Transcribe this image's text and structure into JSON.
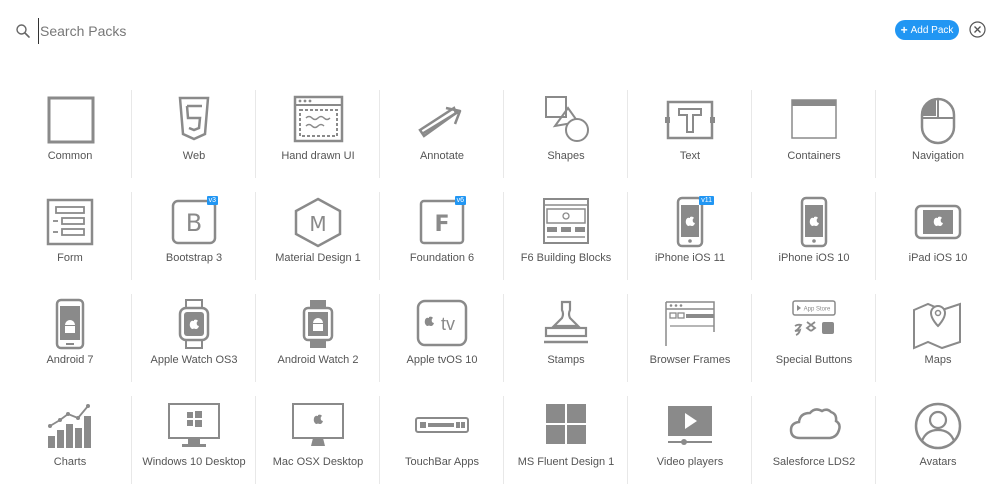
{
  "search": {
    "placeholder": "Search Packs"
  },
  "toolbar": {
    "add_pack_label": "Add Pack",
    "add_pack_plus": "+"
  },
  "packs": [
    {
      "label": "Common",
      "icon": "square-icon"
    },
    {
      "label": "Web",
      "icon": "html5-icon"
    },
    {
      "label": "Hand drawn UI",
      "icon": "hand-drawn-window-icon"
    },
    {
      "label": "Annotate",
      "icon": "arrow-icon"
    },
    {
      "label": "Shapes",
      "icon": "shapes-icon"
    },
    {
      "label": "Text",
      "icon": "text-icon"
    },
    {
      "label": "Containers",
      "icon": "container-icon"
    },
    {
      "label": "Navigation",
      "icon": "mouse-icon"
    },
    {
      "label": "Form",
      "icon": "form-icon"
    },
    {
      "label": "Bootstrap 3",
      "icon": "bootstrap-icon",
      "badge": "v3"
    },
    {
      "label": "Material Design 1",
      "icon": "material-icon"
    },
    {
      "label": "Foundation 6",
      "icon": "foundation-icon",
      "badge": "v6"
    },
    {
      "label": "F6 Building Blocks",
      "icon": "building-blocks-icon"
    },
    {
      "label": "iPhone iOS 11",
      "icon": "iphone-icon",
      "badge": "v11"
    },
    {
      "label": "iPhone iOS 10",
      "icon": "iphone-dark-icon"
    },
    {
      "label": "iPad iOS 10",
      "icon": "ipad-icon"
    },
    {
      "label": "Android 7",
      "icon": "android-phone-icon"
    },
    {
      "label": "Apple Watch OS3",
      "icon": "apple-watch-icon"
    },
    {
      "label": "Android Watch 2",
      "icon": "android-watch-icon"
    },
    {
      "label": "Apple tvOS 10",
      "icon": "apple-tv-icon",
      "icon_text": "tv"
    },
    {
      "label": "Stamps",
      "icon": "stamp-icon"
    },
    {
      "label": "Browser Frames",
      "icon": "browser-frame-icon"
    },
    {
      "label": "Special Buttons",
      "icon": "special-buttons-icon",
      "icon_text": "App Store"
    },
    {
      "label": "Maps",
      "icon": "map-icon"
    },
    {
      "label": "Charts",
      "icon": "chart-icon"
    },
    {
      "label": "Windows 10 Desktop",
      "icon": "windows-desktop-icon"
    },
    {
      "label": "Mac OSX Desktop",
      "icon": "mac-desktop-icon"
    },
    {
      "label": "TouchBar Apps",
      "icon": "touchbar-icon"
    },
    {
      "label": "MS Fluent Design 1",
      "icon": "fluent-icon"
    },
    {
      "label": "Video players",
      "icon": "video-player-icon"
    },
    {
      "label": "Salesforce LDS2",
      "icon": "cloud-icon"
    },
    {
      "label": "Avatars",
      "icon": "avatar-icon"
    }
  ],
  "colors": {
    "accent": "#2196f3",
    "icon": "#8a8a8a",
    "divider": "#e8e8e8"
  }
}
